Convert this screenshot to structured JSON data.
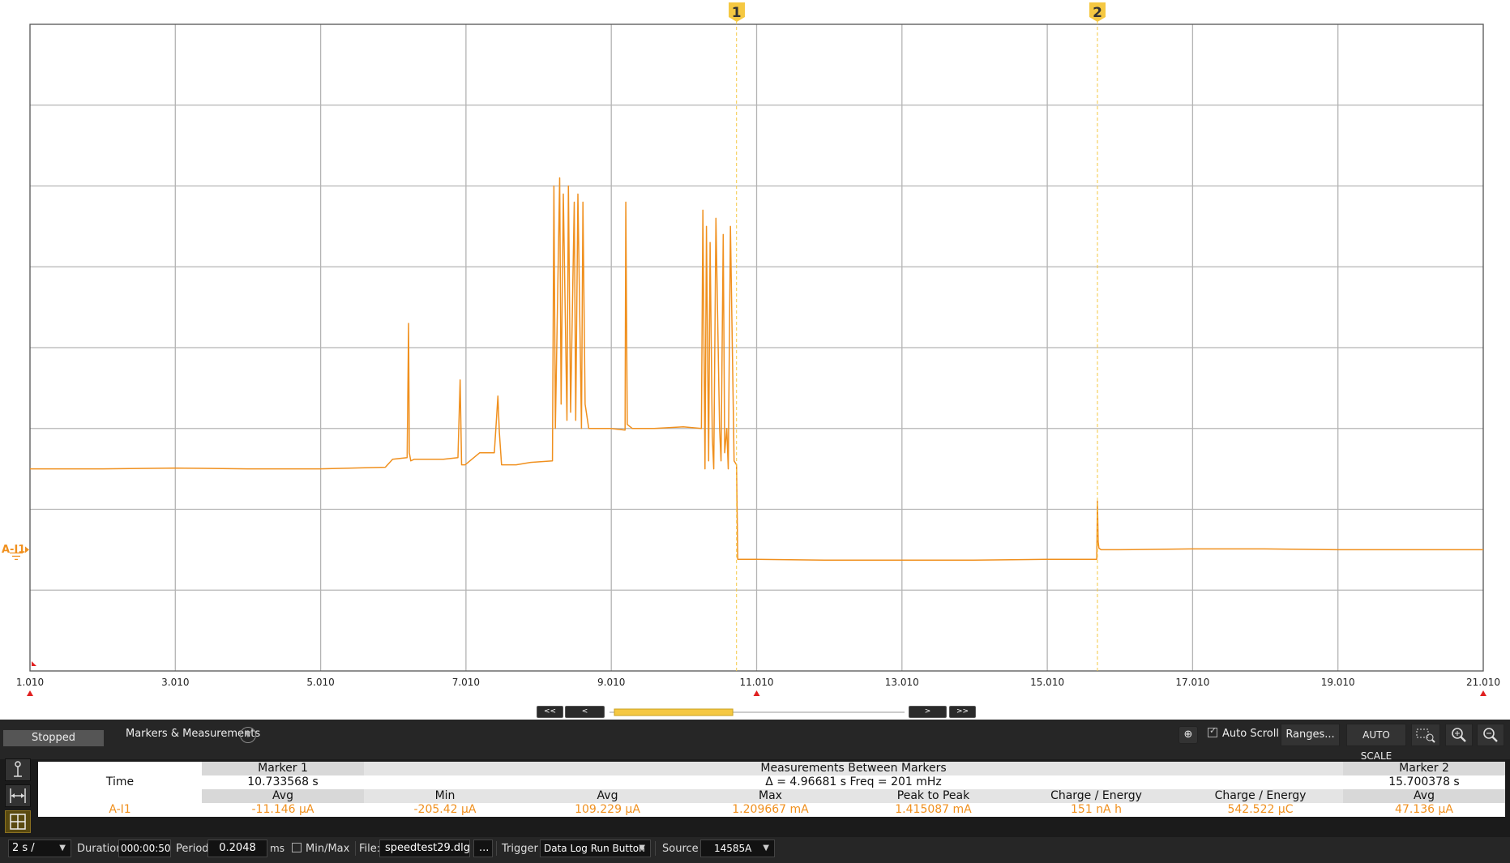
{
  "colors": {
    "trace": "#f0901e",
    "marker_line": "#f5c842",
    "grid": "#b4b4b4",
    "plot_bg": "#ffffff",
    "toolbar_bg": "#262626",
    "trigger_arrow": "#e02020"
  },
  "markers": [
    {
      "label": "1",
      "time": 10.733568
    },
    {
      "label": "2",
      "time": 15.700378
    }
  ],
  "channel": {
    "name": "A-I1",
    "icon": "ground-symbol-icon"
  },
  "chart_data": {
    "type": "line",
    "xlim": [
      1.01,
      21.01
    ],
    "x_ticks": [
      "1.010",
      "3.010",
      "5.010",
      "7.010",
      "9.010",
      "11.010",
      "13.010",
      "15.010",
      "17.010",
      "19.010",
      "21.010"
    ],
    "grid": true,
    "series": [
      {
        "x": [
          1.01,
          2.0,
          3.0,
          4.0,
          5.0,
          5.9,
          6.0,
          6.2,
          6.22,
          6.23,
          6.25,
          6.3,
          6.5,
          6.7,
          6.9,
          6.93,
          6.95,
          7.0,
          7.2,
          7.4,
          7.45,
          7.47,
          7.5,
          7.6,
          7.7,
          7.9,
          8.2,
          8.22,
          8.24,
          8.3,
          8.32,
          8.35,
          8.4,
          8.42,
          8.45,
          8.5,
          8.52,
          8.55,
          8.6,
          8.62,
          8.65,
          8.7,
          9.0,
          9.2,
          9.21,
          9.23,
          9.3,
          9.6,
          10.0,
          10.25,
          10.27,
          10.3,
          10.32,
          10.35,
          10.37,
          10.4,
          10.42,
          10.45,
          10.5,
          10.52,
          10.55,
          10.57,
          10.6,
          10.62,
          10.65,
          10.7,
          10.733,
          10.75,
          11.0,
          12.0,
          13.0,
          14.0,
          15.0,
          15.69,
          15.7,
          15.71,
          15.72,
          15.75,
          16.0,
          17.0,
          18.0,
          19.0,
          20.0,
          21.01
        ],
        "y": [
          1.0,
          1.0,
          1.01,
          1.0,
          1.0,
          1.02,
          1.12,
          1.14,
          2.8,
          1.2,
          1.1,
          1.12,
          1.12,
          1.12,
          1.14,
          2.1,
          1.05,
          1.05,
          1.2,
          1.2,
          1.9,
          1.45,
          1.05,
          1.05,
          1.05,
          1.08,
          1.1,
          4.5,
          1.5,
          4.6,
          1.8,
          4.4,
          1.6,
          4.5,
          1.7,
          4.3,
          1.6,
          4.4,
          1.5,
          4.3,
          1.8,
          1.5,
          1.5,
          1.48,
          4.3,
          1.55,
          1.5,
          1.5,
          1.52,
          1.5,
          4.2,
          1.0,
          4.0,
          1.1,
          3.8,
          1.4,
          1.0,
          4.1,
          1.5,
          1.1,
          3.9,
          1.2,
          1.5,
          1.0,
          4.0,
          1.1,
          1.05,
          -0.12,
          -0.12,
          -0.13,
          -0.13,
          -0.13,
          -0.12,
          -0.12,
          0.6,
          0.1,
          0.02,
          0.0,
          0.0,
          0.01,
          0.01,
          0.0,
          0.0,
          0.0
        ]
      }
    ]
  },
  "nav": {
    "first_label": "<<",
    "prev_label": "<",
    "next_label": ">",
    "last_label": ">>",
    "scroll_fraction": 0.415
  },
  "toolbar": {
    "status": "Stopped",
    "markers_measurements_label": "Markers & Measurements",
    "add_icon": "crosshair-plus-icon",
    "auto_scroll_label": "Auto Scroll",
    "ranges_label": "Ranges...",
    "auto_scale_label": "AUTO SCALE",
    "zoom_box_icon": "zoom-box-icon",
    "zoom_in_icon": "zoom-in-icon",
    "zoom_out_icon": "zoom-out-icon"
  },
  "side_tools": [
    "probe-icon",
    "marker-span-icon",
    "grid-layout-icon"
  ],
  "measurements": {
    "marker1_header": "Marker 1",
    "between_header": "Measurements Between Markers",
    "marker2_header": "Marker 2",
    "time_label": "Time",
    "marker1_time": "10.733568 s",
    "delta": "Δ = 4.96681 s   Freq = 201 mHz",
    "marker2_time": "15.700378 s",
    "columns": {
      "m1_avg": "Avg",
      "min": "Min",
      "avg": "Avg",
      "max": "Max",
      "p2p": "Peak to Peak",
      "charge1": "Charge / Energy",
      "charge2": "Charge / Energy",
      "m2_avg": "Avg"
    },
    "row": {
      "channel": "A-I1",
      "m1_avg": "-11.146 µA",
      "min": "-205.42 µA",
      "avg": "109.229 µA",
      "max": "1.209667 mA",
      "p2p": "1.415087 mA",
      "charge1": "151 nA h",
      "charge2": "542.522 µC",
      "m2_avg": "47.136 µA"
    }
  },
  "bottom": {
    "timebase": "2 s /",
    "duration_label": "Duration:",
    "duration": "000:00:50",
    "period_label": "Period:",
    "period": "0.2048",
    "period_unit": "ms",
    "minmax_label": "Min/Max",
    "file_label": "File:",
    "file": "speedtest29.dlg",
    "browse_label": "...",
    "trigger_label": "Trigger",
    "trigger_value": "Data Log Run Button",
    "source_label": "Source",
    "source_value": "14585A"
  }
}
